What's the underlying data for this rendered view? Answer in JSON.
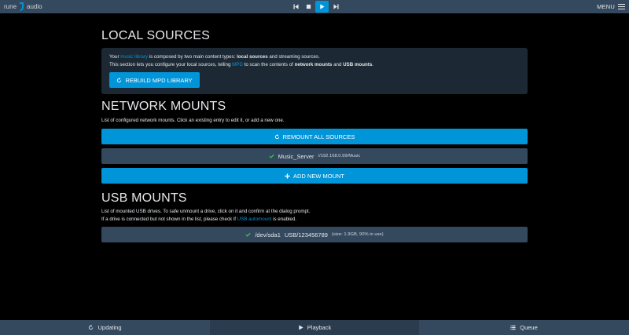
{
  "app": {
    "logo_left": "rune",
    "logo_right": "audio",
    "menu_label": "MENU"
  },
  "transport": {
    "icons": [
      "skip-previous-icon",
      "stop-icon",
      "play-icon",
      "skip-next-icon"
    ]
  },
  "local_sources": {
    "title": "LOCAL SOURCES",
    "line1_a": "Your ",
    "line1_link": "music library",
    "line1_b": " is composed by two main content types: ",
    "line1_bold1": "local sources",
    "line1_c": " and streaming sources.",
    "line2_a": "This section lets you configure your local sources, telling ",
    "line2_link": "MPD",
    "line2_b": " to scan the contents of ",
    "line2_bold1": "network mounts",
    "line2_c": " and ",
    "line2_bold2": "USB mounts",
    "line2_d": ".",
    "rebuild_label": "REBUILD MPD LIBRARY"
  },
  "network_mounts": {
    "title": "NETWORK MOUNTS",
    "description": "List of configured network mounts. Click an existing entry to edit it, or add a new one.",
    "remount_label": "REMOUNT ALL SOURCES",
    "entries": [
      {
        "name": "Music_Server",
        "path": "//192.168.0.99/Music"
      }
    ],
    "add_label": "ADD NEW MOUNT"
  },
  "usb_mounts": {
    "title": "USB MOUNTS",
    "line1": "List of mounted USB drives. To safe unmount a drive, click on it and confirm at the dialog prompt.",
    "line2_a": "If a drive is connected but not shown in the list, please check if ",
    "line2_link": "USB automount",
    "line2_b": " is enabled.",
    "entries": [
      {
        "device": "/dev/sda1",
        "label": "USB/123456789",
        "info": "(size: 1.9GB, 90% in use)"
      }
    ]
  },
  "bottom_tabs": [
    {
      "label": "Updating",
      "icon": "refresh-icon"
    },
    {
      "label": "Playback",
      "icon": "play-icon"
    },
    {
      "label": "Queue",
      "icon": "list-icon"
    }
  ],
  "colors": {
    "accent": "#0095d8",
    "bar": "#34495e",
    "panel": "#1c2833",
    "success": "#2ecc40"
  }
}
